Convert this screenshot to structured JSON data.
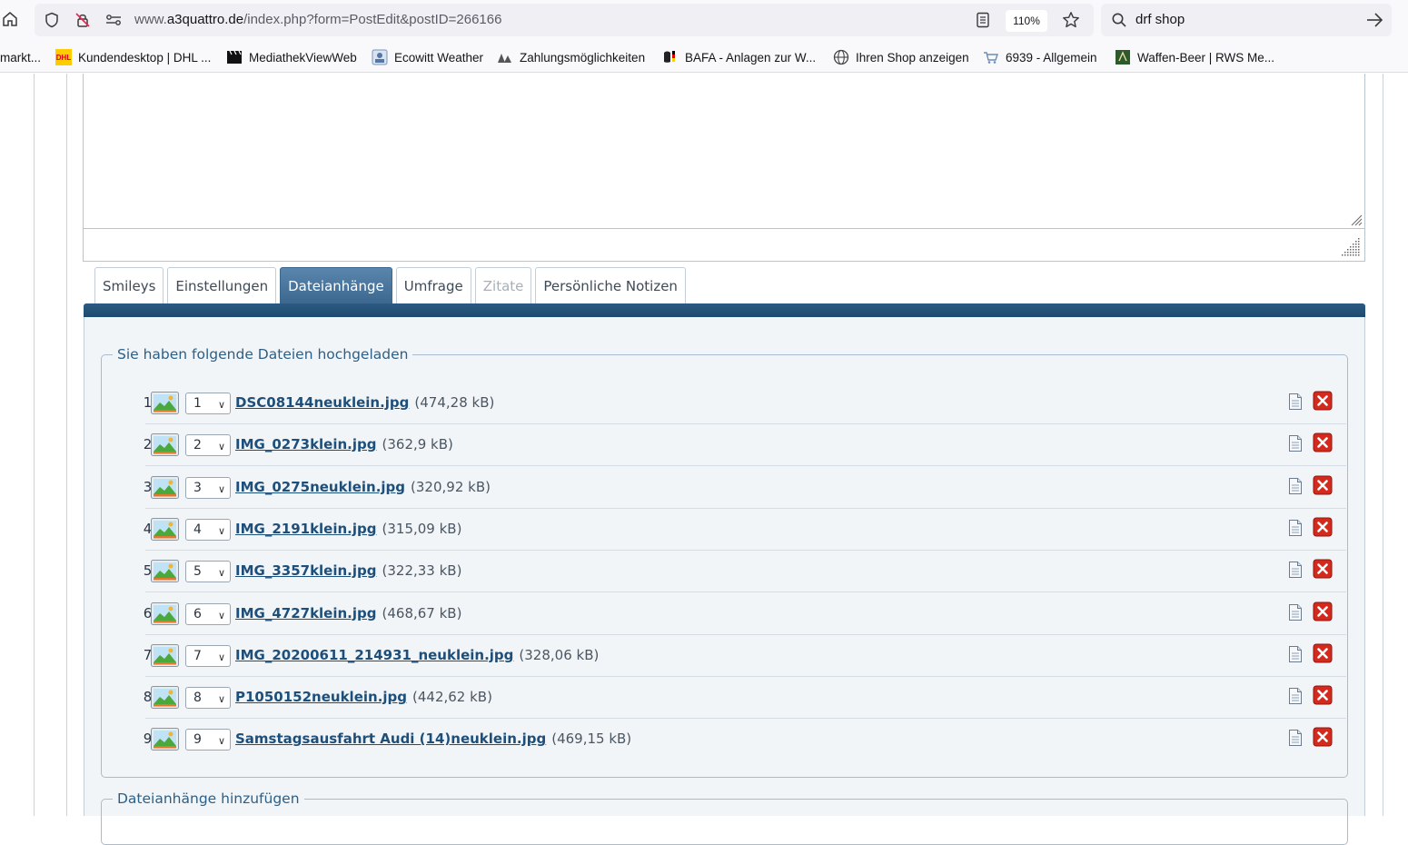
{
  "browser": {
    "url_prefix": "www.",
    "url_host": "a3quattro.de",
    "url_path": "/index.php?form=PostEdit&postID=266166",
    "zoom": "110%",
    "search_query": "drf shop",
    "bookmarks": [
      {
        "label": "markt..."
      },
      {
        "label": "Kundendesktop | DHL ..."
      },
      {
        "label": "MediathekViewWeb"
      },
      {
        "label": "Ecowitt Weather"
      },
      {
        "label": "Zahlungsmöglichkeiten"
      },
      {
        "label": "BAFA - Anlagen zur W..."
      },
      {
        "label": "Ihren Shop anzeigen"
      },
      {
        "label": "6939 - Allgemein"
      },
      {
        "label": "Waffen-Beer | RWS Me..."
      }
    ]
  },
  "tabs": [
    {
      "label": "Smileys",
      "state": "normal"
    },
    {
      "label": "Einstellungen",
      "state": "normal"
    },
    {
      "label": "Dateianhänge",
      "state": "active"
    },
    {
      "label": "Umfrage",
      "state": "normal"
    },
    {
      "label": "Zitate",
      "state": "disabled"
    },
    {
      "label": "Persönliche Notizen",
      "state": "normal"
    }
  ],
  "uploaded": {
    "legend": "Sie haben folgende Dateien hochgeladen",
    "files": [
      {
        "num": "1.",
        "order": "1",
        "name": "DSC08144neuklein.jpg",
        "size": "(474,28 kB)"
      },
      {
        "num": "2.",
        "order": "2",
        "name": "IMG_0273klein.jpg",
        "size": "(362,9 kB)"
      },
      {
        "num": "3.",
        "order": "3",
        "name": "IMG_0275neuklein.jpg",
        "size": "(320,92 kB)"
      },
      {
        "num": "4.",
        "order": "4",
        "name": "IMG_2191klein.jpg",
        "size": "(315,09 kB)"
      },
      {
        "num": "5.",
        "order": "5",
        "name": "IMG_3357klein.jpg",
        "size": "(322,33 kB)"
      },
      {
        "num": "6.",
        "order": "6",
        "name": "IMG_4727klein.jpg",
        "size": "(468,67 kB)"
      },
      {
        "num": "7.",
        "order": "7",
        "name": "IMG_20200611_214931_neuklein.jpg",
        "size": "(328,06 kB)"
      },
      {
        "num": "8.",
        "order": "8",
        "name": "P1050152neuklein.jpg",
        "size": "(442,62 kB)"
      },
      {
        "num": "9.",
        "order": "9",
        "name": "Samstagsausfahrt Audi (14)neuklein.jpg",
        "size": "(469,15 kB)"
      }
    ]
  },
  "add_attachments": {
    "legend": "Dateianhänge hinzufügen"
  },
  "colors": {
    "tab_active": "#3c678e",
    "link": "#1e4f7a",
    "legend": "#2c5f87",
    "delete": "#d42a1e"
  }
}
